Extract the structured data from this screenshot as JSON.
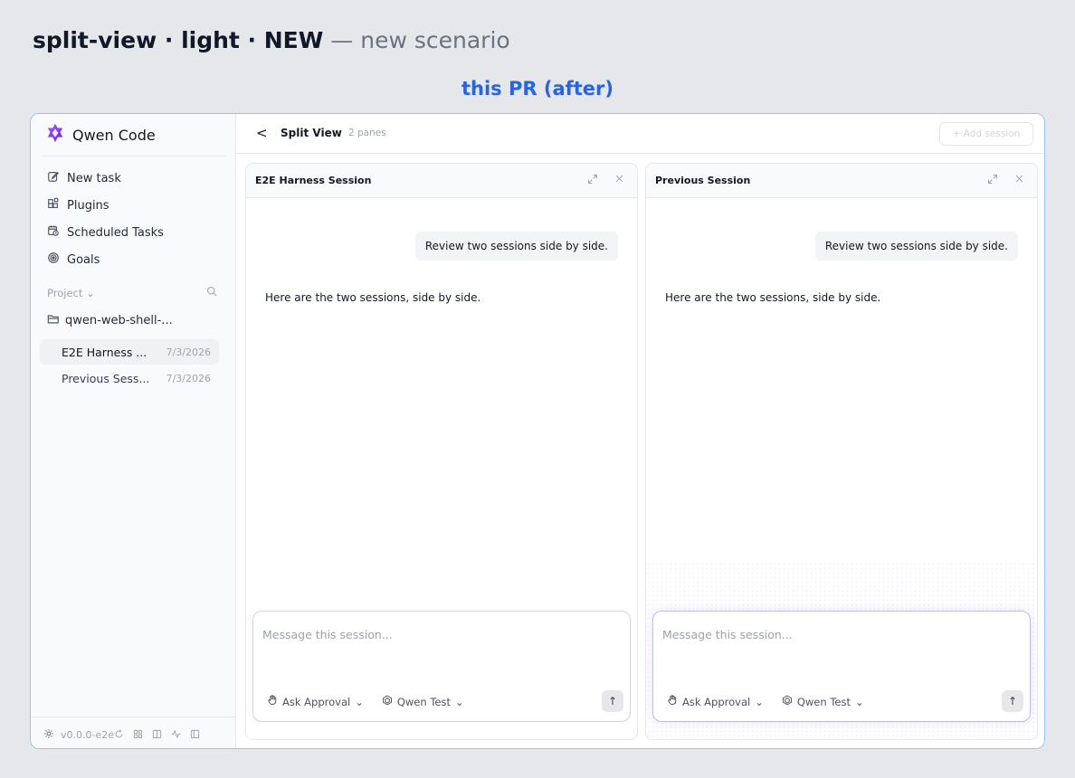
{
  "heading": {
    "bold": "split-view · light · NEW",
    "sub": "— new scenario"
  },
  "caption": "this PR (after)",
  "sidebar": {
    "app_name": "Qwen Code",
    "nav": [
      {
        "label": "New task",
        "icon": "edit-icon"
      },
      {
        "label": "Plugins",
        "icon": "plugins-icon"
      },
      {
        "label": "Scheduled Tasks",
        "icon": "calendar-clock-icon"
      },
      {
        "label": "Goals",
        "icon": "target-icon"
      }
    ],
    "project_label": "Project",
    "folder": "qwen-web-shell-...",
    "sessions": [
      {
        "name": "E2E Harness ...",
        "date": "7/3/2026"
      },
      {
        "name": "Previous Sess...",
        "date": "7/3/2026"
      }
    ],
    "version": "v0.0.0-e2e"
  },
  "topbar": {
    "back": "<",
    "title": "Split View",
    "subtitle": "2 panes",
    "add_session": "+ Add session"
  },
  "panes": [
    {
      "title": "E2E Harness Session",
      "user_message": "Review two sessions side by side.",
      "assistant_message": "Here are the two sessions, side by side.",
      "placeholder": "Message this session...",
      "approval": "Ask Approval",
      "model": "Qwen Test"
    },
    {
      "title": "Previous Session",
      "user_message": "Review two sessions side by side.",
      "assistant_message": "Here are the two sessions, side by side.",
      "placeholder": "Message this session...",
      "approval": "Ask Approval",
      "model": "Qwen Test"
    }
  ],
  "colors": {
    "accent": "#2563eb",
    "frame_border": "#93c5fd",
    "focus": "#c4b5fd"
  }
}
